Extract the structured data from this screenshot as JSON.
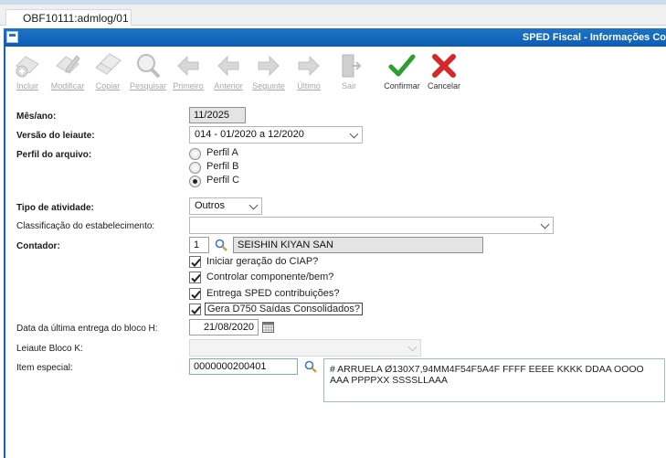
{
  "tab": {
    "label": "OBF10111:admlog/01"
  },
  "window": {
    "title": "SPED Fiscal - Informações Co"
  },
  "toolbar": {
    "buttons": [
      {
        "label": "Incluir",
        "icon": "add-icon",
        "enabled": false
      },
      {
        "label": "Modificar",
        "icon": "edit-icon",
        "enabled": false
      },
      {
        "label": "Copiar",
        "icon": "copy-icon",
        "enabled": false
      },
      {
        "label": "Pesquisar",
        "icon": "search-icon",
        "enabled": false
      },
      {
        "label": "Primeiro",
        "icon": "first-icon",
        "enabled": false
      },
      {
        "label": "Anterior",
        "icon": "previous-icon",
        "enabled": false
      },
      {
        "label": "Seguinte",
        "icon": "next-icon",
        "enabled": false
      },
      {
        "label": "Último",
        "icon": "last-icon",
        "enabled": false
      },
      {
        "label": "Sair",
        "icon": "exit-icon",
        "enabled": false
      },
      {
        "label": "Confirmar",
        "icon": "confirm-icon",
        "enabled": true
      },
      {
        "label": "Cancelar",
        "icon": "cancel-icon",
        "enabled": true
      }
    ]
  },
  "form": {
    "mes_ano": {
      "label": "Mês/ano:",
      "value": "11/2025"
    },
    "versao": {
      "label": "Versão do leiaute:",
      "value": "014 - 01/2020 a 12/2020"
    },
    "perfil": {
      "label": "Perfil do arquivo:",
      "options": [
        "Perfil A",
        "Perfil B",
        "Perfil C"
      ],
      "selected": "Perfil C"
    },
    "tipo_atividade": {
      "label": "Tipo de atividade:",
      "value": "Outros"
    },
    "classificacao": {
      "label": "Classificação do estabelecimento:",
      "value": ""
    },
    "contador": {
      "label": "Contador:",
      "code": "1",
      "name": "SEISHIN KIYAN SAN"
    },
    "checkboxes": [
      {
        "label": "Iniciar geração do CIAP?",
        "checked": true
      },
      {
        "label": "Controlar componente/bem?",
        "checked": true
      },
      {
        "label": "Entrega SPED contribuições?",
        "checked": true
      },
      {
        "label": "Gera D750 Saídas Consolidados?",
        "checked": true
      }
    ],
    "data_ultima_entrega": {
      "label": "Data da última entrega do bloco H:",
      "value": "21/08/2020"
    },
    "leiaute_bloco_k": {
      "label": "Leiaute Bloco K:",
      "value": ""
    },
    "item_especial": {
      "label": "Item especial:",
      "code": "0000000200401",
      "description": "# ARRUELA Ø130X7,94MM4F54F5A4F FFFF EEEE KKKK DDAA OOOO AAA PPPPXX SSSSLLAAA"
    }
  },
  "colors": {
    "title_bar": "#0a5db3",
    "confirm": "#2e9e2e",
    "cancel": "#d62828"
  }
}
